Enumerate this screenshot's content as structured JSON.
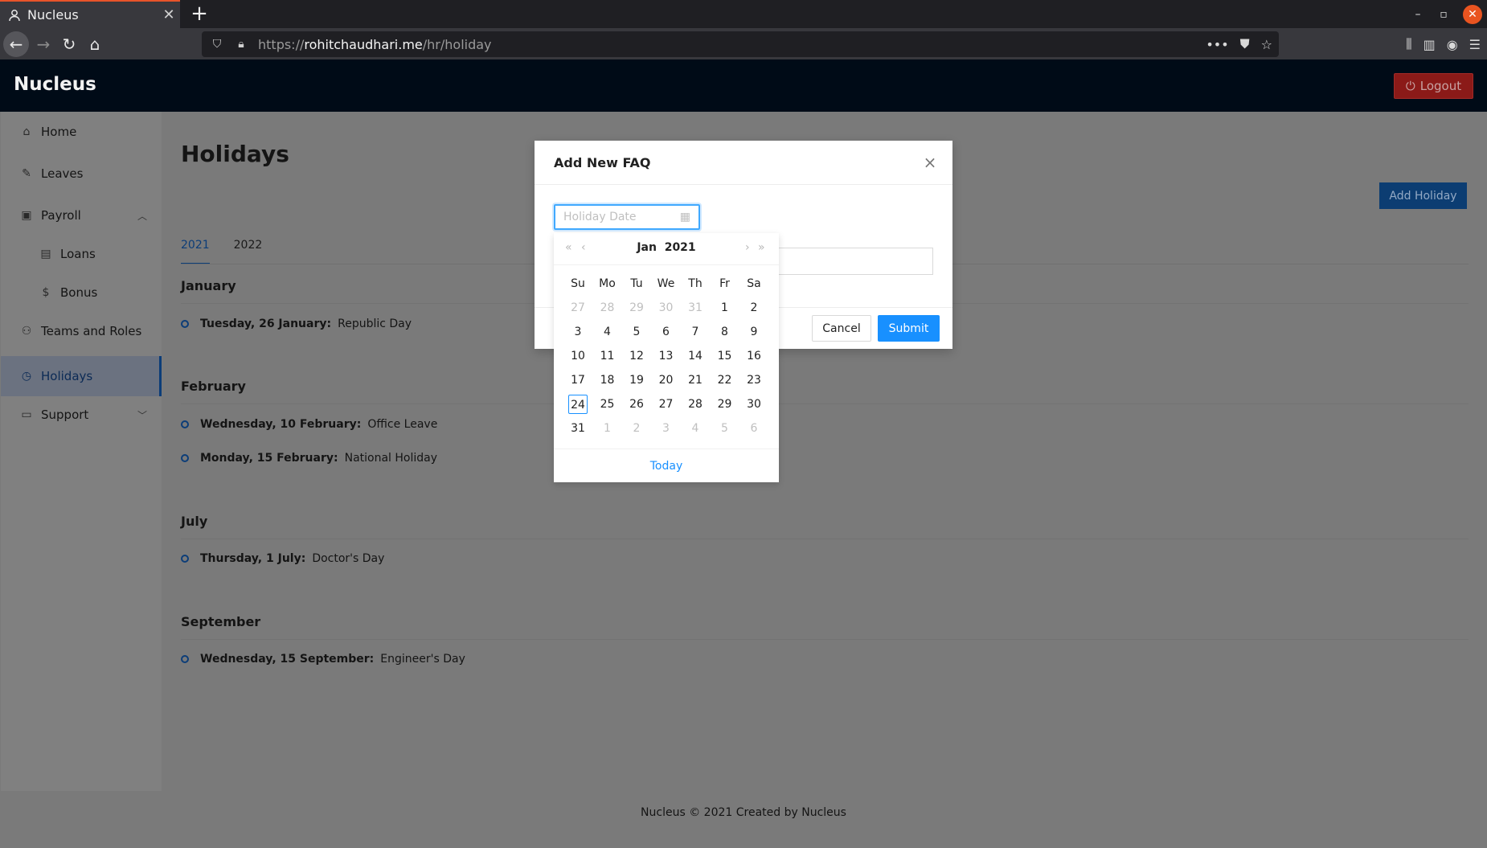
{
  "browser": {
    "tab_title": "Nucleus",
    "url_prefix": "https://",
    "url_domain": "rohitchaudhari.me",
    "url_path": "/hr/holiday"
  },
  "app": {
    "brand": "Nucleus",
    "logout_label": "Logout"
  },
  "sidebar": {
    "items": [
      {
        "label": "Home",
        "icon": "home-icon"
      },
      {
        "label": "Leaves",
        "icon": "edit-icon"
      },
      {
        "label": "Payroll",
        "icon": "payroll-icon"
      },
      {
        "label": "Loans",
        "icon": "file-icon"
      },
      {
        "label": "Bonus",
        "icon": "dollar-circle-icon"
      },
      {
        "label": "Teams and Roles",
        "icon": "team-icon"
      },
      {
        "label": "Holidays",
        "icon": "clock-icon"
      },
      {
        "label": "Support",
        "icon": "laptop-icon"
      }
    ]
  },
  "page": {
    "title": "Holidays",
    "add_button": "Add Holiday",
    "tabs": [
      "2021",
      "2022"
    ],
    "months": [
      {
        "name": "January",
        "holidays": [
          {
            "date": "Tuesday, 26 January:",
            "name": "Republic Day"
          }
        ]
      },
      {
        "name": "February",
        "holidays": [
          {
            "date": "Wednesday, 10 February:",
            "name": "Office Leave"
          },
          {
            "date": "Monday, 15 February:",
            "name": "National Holiday"
          }
        ]
      },
      {
        "name": "July",
        "holidays": [
          {
            "date": "Thursday, 1 July:",
            "name": "Doctor's Day"
          }
        ]
      },
      {
        "name": "September",
        "holidays": [
          {
            "date": "Wednesday, 15 September:",
            "name": "Engineer's Day"
          }
        ]
      }
    ]
  },
  "footer": "Nucleus © 2021 Created by Nucleus",
  "modal": {
    "title": "Add New FAQ",
    "date_placeholder": "Holiday Date",
    "cancel_label": "Cancel",
    "submit_label": "Submit"
  },
  "picker": {
    "month": "Jan",
    "year": "2021",
    "weekdays": [
      "Su",
      "Mo",
      "Tu",
      "We",
      "Th",
      "Fr",
      "Sa"
    ],
    "weeks": [
      [
        "27",
        "28",
        "29",
        "30",
        "31",
        "1",
        "2"
      ],
      [
        "3",
        "4",
        "5",
        "6",
        "7",
        "8",
        "9"
      ],
      [
        "10",
        "11",
        "12",
        "13",
        "14",
        "15",
        "16"
      ],
      [
        "17",
        "18",
        "19",
        "20",
        "21",
        "22",
        "23"
      ],
      [
        "24",
        "25",
        "26",
        "27",
        "28",
        "29",
        "30"
      ],
      [
        "31",
        "1",
        "2",
        "3",
        "4",
        "5",
        "6"
      ]
    ],
    "today_label": "Today"
  },
  "colors": {
    "accent": "#1890ff",
    "header_bg": "#000b17",
    "logout_bg": "#8b1a18",
    "active_blue": "#0c3d78"
  }
}
